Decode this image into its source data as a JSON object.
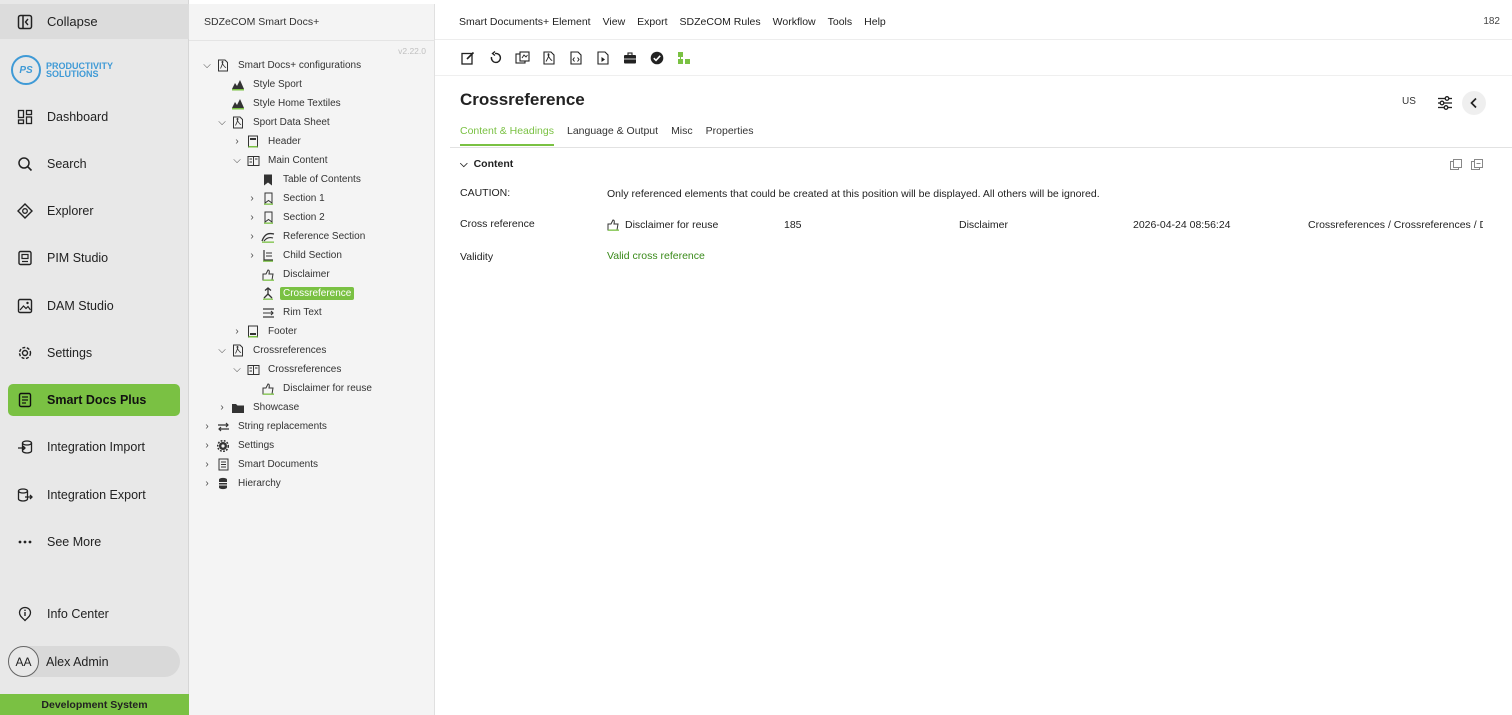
{
  "nav": {
    "collapse": "Collapse",
    "logo": {
      "initials": "PS",
      "line1": "PRODUCTIVITY",
      "line2": "SOLUTIONS"
    },
    "items": [
      {
        "label": "Dashboard",
        "icon": "dashboard-icon"
      },
      {
        "label": "Search",
        "icon": "search-icon"
      },
      {
        "label": "Explorer",
        "icon": "explorer-icon"
      },
      {
        "label": "PIM Studio",
        "icon": "pim-icon"
      },
      {
        "label": "DAM Studio",
        "icon": "image-icon"
      },
      {
        "label": "Settings",
        "icon": "gear-icon"
      },
      {
        "label": "Smart Docs Plus",
        "icon": "document-icon",
        "active": true
      },
      {
        "label": "Integration Import",
        "icon": "import-icon"
      },
      {
        "label": "Integration Export",
        "icon": "export-icon"
      },
      {
        "label": "See More",
        "icon": "more-icon"
      },
      {
        "label": "Info Center",
        "icon": "info-icon"
      }
    ],
    "user": {
      "initials": "AA",
      "name": "Alex Admin"
    },
    "system": "Development System"
  },
  "tree": {
    "title": "SDZeCOM Smart Docs+",
    "version": "v2.22.0",
    "nodes": [
      {
        "label": "Smart Docs+ configurations",
        "expander": "open"
      },
      {
        "label": "Style Sport"
      },
      {
        "label": "Style Home Textiles"
      },
      {
        "label": "Sport Data Sheet",
        "expander": "open"
      },
      {
        "label": "Header",
        "expander": "closed"
      },
      {
        "label": "Main Content",
        "expander": "open"
      },
      {
        "label": "Table of Contents"
      },
      {
        "label": "Section 1",
        "expander": "closed"
      },
      {
        "label": "Section 2",
        "expander": "closed"
      },
      {
        "label": "Reference Section",
        "expander": "closed"
      },
      {
        "label": "Child Section",
        "expander": "closed"
      },
      {
        "label": "Disclaimer"
      },
      {
        "label": "Crossreference",
        "selected": true
      },
      {
        "label": "Rim Text"
      },
      {
        "label": "Footer",
        "expander": "closed"
      },
      {
        "label": "Crossreferences",
        "expander": "open"
      },
      {
        "label": "Crossreferences",
        "expander": "open"
      },
      {
        "label": "Disclaimer for reuse"
      },
      {
        "label": "Showcase",
        "expander": "closed"
      },
      {
        "label": "String replacements",
        "expander": "closed"
      },
      {
        "label": "Settings",
        "expander": "closed"
      },
      {
        "label": "Smart Documents",
        "expander": "closed"
      },
      {
        "label": "Hierarchy",
        "expander": "closed"
      }
    ]
  },
  "menu": {
    "items": [
      "Smart Documents+ Element",
      "View",
      "Export",
      "SDZeCOM Rules",
      "Workflow",
      "Tools",
      "Help"
    ],
    "count": "182"
  },
  "toolbar": [
    "edit-icon",
    "reload-icon",
    "compare-icon",
    "pdf-icon",
    "xml-icon",
    "preview-icon",
    "briefcase-icon",
    "check-icon",
    "structure-icon"
  ],
  "header": {
    "title": "Crossreference",
    "language": "US"
  },
  "tabs": [
    "Content & Headings",
    "Language & Output",
    "Misc",
    "Properties"
  ],
  "content": {
    "section": "Content",
    "caution_label": "CAUTION:",
    "caution_text": "Only referenced elements that could be created at this position will be displayed. All others will be ignored.",
    "crossref_label": "Cross reference",
    "crossref": {
      "name": "Disclaimer for reuse",
      "id": "185",
      "type": "Disclaimer",
      "date": "2026-04-24 08:56:24",
      "path": "Crossreferences / Crossreferences / Disclaimer for reuse"
    },
    "validity_label": "Validity",
    "validity_value": "Valid cross reference"
  },
  "colors": {
    "accent": "#7ac143",
    "valid": "#3a8a1a",
    "logo": "#3f9ad6"
  }
}
